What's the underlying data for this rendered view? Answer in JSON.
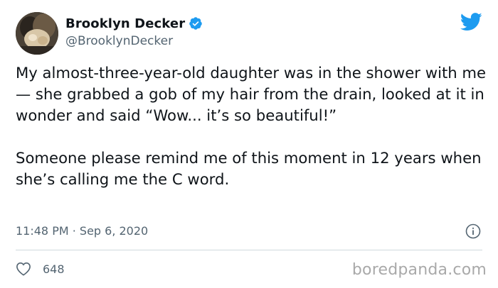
{
  "author": {
    "display_name": "Brooklyn Decker",
    "handle": "@BrooklynDecker",
    "verified": true,
    "avatar_icon": "profile-photo"
  },
  "tweet": {
    "paragraphs": [
      "My almost-three-year-old daughter was in the shower with me— she grabbed a gob of my hair from the drain, looked at it in wonder and said “Wow... it’s so beautiful!”",
      "Someone please remind me of this moment in 12 years when she’s calling me the C word."
    ],
    "timestamp": "11:48 PM · Sep 6, 2020"
  },
  "stats": {
    "likes": "648"
  },
  "watermark": "boredpanda.com",
  "icons": {
    "brand": "twitter-bird-icon",
    "verified": "verified-badge-icon",
    "info": "info-icon",
    "like": "heart-icon"
  },
  "colors": {
    "brand_blue": "#1d9bf0",
    "text_primary": "#0f1419",
    "text_secondary": "#536471",
    "divider": "#cfd9de",
    "watermark": "#a9a9a9"
  }
}
